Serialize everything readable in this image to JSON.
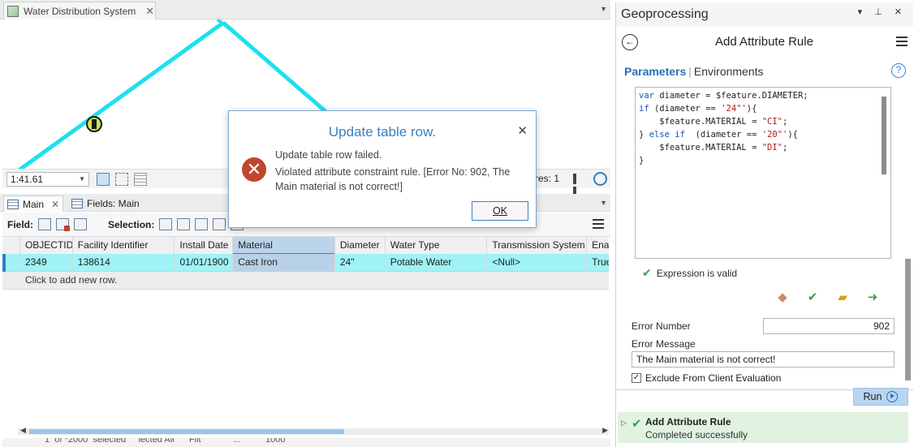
{
  "map": {
    "tab_title": "Water Distribution System",
    "scale": "1:41.61",
    "features_label": "res: 1"
  },
  "table": {
    "tabs": [
      {
        "label": "Main"
      },
      {
        "label": "Fields:  Main"
      }
    ],
    "toolbar": {
      "field_label": "Field:",
      "selection_label": "Selection:"
    },
    "columns": [
      "OBJECTID",
      "Facility Identifier",
      "Install Date",
      "Material",
      "Diameter",
      "Water Type",
      "Transmission System",
      "Ena"
    ],
    "row": [
      "2349",
      "138614",
      "01/01/1900",
      "Cast Iron",
      "24\"",
      "Potable Water",
      "<Null>",
      "True"
    ],
    "add_row_text": "Click to add new row.",
    "status_text": "1  of *2000  selected     lected All      Filt             ...          1000"
  },
  "dialog": {
    "title": "Update table row.",
    "line1": "Update table row failed.",
    "line2": "Violated attribute constraint rule. [Error No: 902, The Main material is not correct!]",
    "ok_label": "OK"
  },
  "geoprocessing": {
    "pane_title": "Geoprocessing",
    "tool_title": "Add Attribute Rule",
    "tab_parameters": "Parameters",
    "tab_environments": "Environments",
    "code": {
      "l1a": "var",
      "l1b": " diameter = $feature.DIAMETER;",
      "l2a": "if",
      "l2b": " (diameter == ",
      "l2c": "'24\"'",
      "l2d": "){",
      "l3a": "    $feature.MATERIAL = ",
      "l3b": "\"CI\"",
      "l3c": ";",
      "l4a": "} ",
      "l4b": "else if",
      "l4c": "  (diameter == ",
      "l4d": "'20\"'",
      "l4e": "){",
      "l5a": "    $feature.MATERIAL = ",
      "l5b": "\"DI\"",
      "l5c": ";",
      "l6": "}"
    },
    "expression_status": "Expression is valid",
    "error_number_label": "Error Number",
    "error_number_value": "902",
    "error_message_label": "Error Message",
    "error_message_value": "The Main material is not correct!",
    "exclude_label": "Exclude From Client Evaluation",
    "exclude_checked": true,
    "run_label": "Run",
    "result_title": "Add Attribute Rule",
    "result_status": "Completed successfully"
  },
  "colors": {
    "pipe": "#1ee0ee",
    "selected_row": "#9ff3f7",
    "accent": "#3a7fbf",
    "error": "#c0462e",
    "success": "#3aa04f"
  }
}
